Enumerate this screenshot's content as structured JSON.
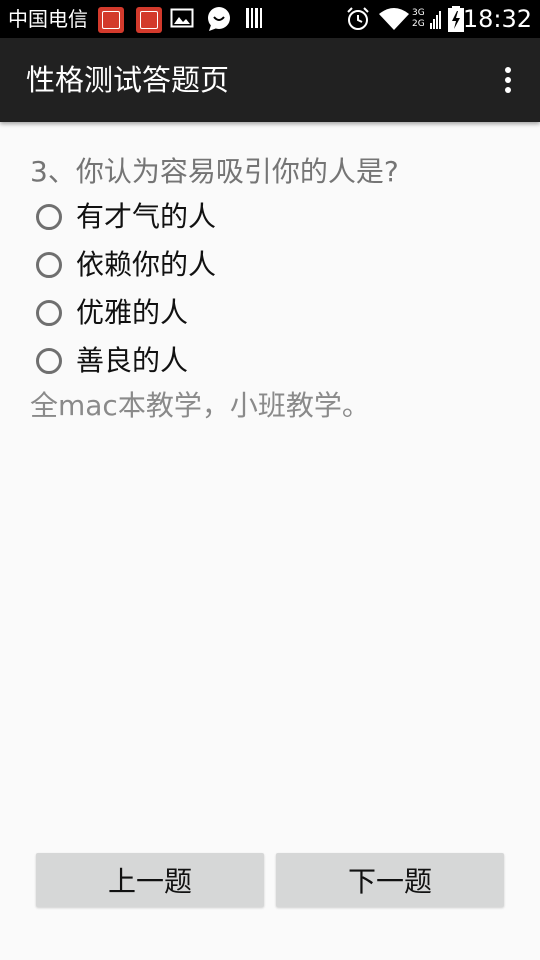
{
  "status_bar": {
    "carrier": "中国电信",
    "time": "18:32",
    "network_labels": [
      "3G",
      "2G"
    ],
    "icons": [
      "app-badge-icon",
      "app-badge-icon",
      "image-icon",
      "chat-icon",
      "barcode-icon",
      "alarm-icon",
      "wifi-icon",
      "signal-icon",
      "battery-icon"
    ]
  },
  "action_bar": {
    "title": "性格测试答题页",
    "menu_icon": "overflow-menu-icon"
  },
  "quiz": {
    "question": "3、你认为容易吸引你的人是?",
    "options": [
      {
        "label": "有才气的人",
        "selected": false
      },
      {
        "label": "依赖你的人",
        "selected": false
      },
      {
        "label": "优雅的人",
        "selected": false
      },
      {
        "label": "善良的人",
        "selected": false
      }
    ],
    "note": "全mac本教学，小班教学。"
  },
  "buttons": {
    "prev_label": "上一题",
    "next_label": "下一题"
  },
  "colors": {
    "status_bar": "#000000",
    "action_bar": "#212121",
    "background": "#fafafa",
    "button": "#d6d7d7",
    "app_badge": "#d33a2c"
  }
}
